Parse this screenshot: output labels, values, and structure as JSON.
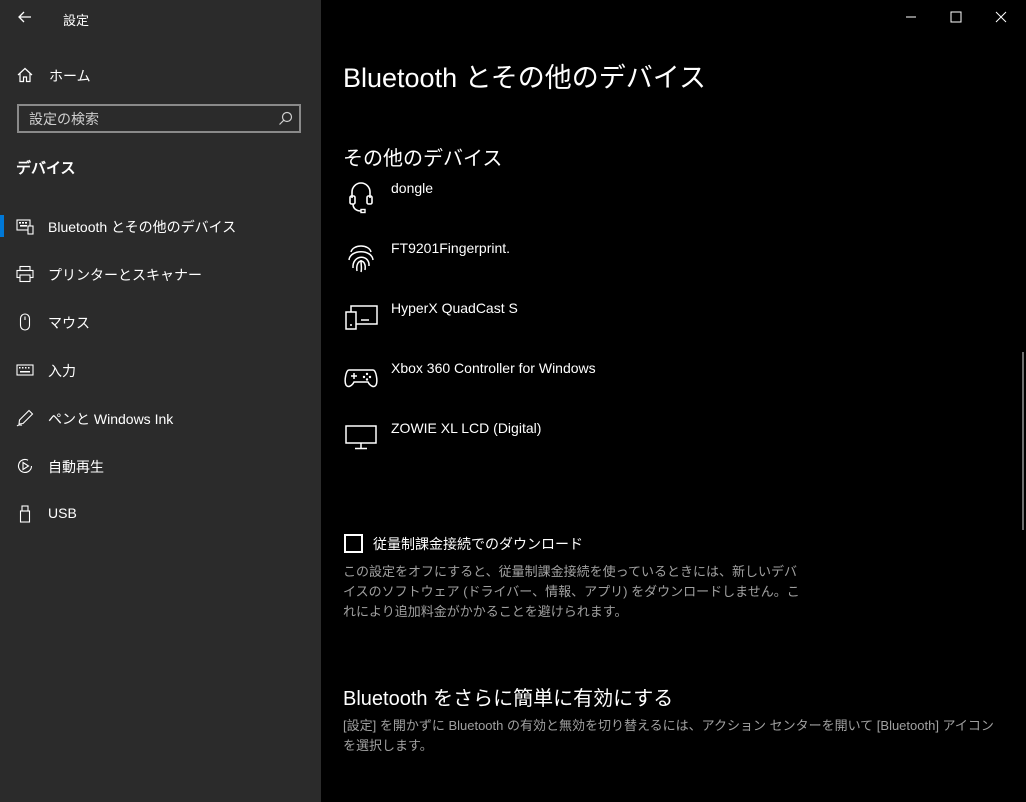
{
  "window": {
    "title": "設定"
  },
  "sidebar": {
    "home_label": "ホーム",
    "search_placeholder": "設定の検索",
    "section_title": "デバイス",
    "items": [
      {
        "label": "Bluetooth とその他のデバイス",
        "icon": "bluetooth-devices-icon",
        "active": true
      },
      {
        "label": "プリンターとスキャナー",
        "icon": "printer-icon"
      },
      {
        "label": "マウス",
        "icon": "mouse-icon"
      },
      {
        "label": "入力",
        "icon": "keyboard-icon"
      },
      {
        "label": "ペンと Windows Ink",
        "icon": "pen-icon"
      },
      {
        "label": "自動再生",
        "icon": "autoplay-icon"
      },
      {
        "label": "USB",
        "icon": "usb-icon"
      }
    ],
    "accent_color": "#0078d7"
  },
  "main": {
    "title": "Bluetooth とその他のデバイス",
    "other_devices_title": "その他のデバイス",
    "devices": [
      {
        "name": "dongle",
        "icon": "headset-icon"
      },
      {
        "name": "FT9201Fingerprint.",
        "icon": "fingerprint-icon"
      },
      {
        "name": "HyperX QuadCast S",
        "icon": "devices-icon"
      },
      {
        "name": "Xbox 360 Controller for Windows",
        "icon": "gamepad-icon"
      },
      {
        "name": "ZOWIE XL LCD (Digital)",
        "icon": "monitor-icon"
      }
    ],
    "metered": {
      "label": "従量制課金接続でのダウンロード",
      "checked": false,
      "description": "この設定をオフにすると、従量制課金接続を使っているときには、新しいデバイスのソフトウェア (ドライバー、情報、アプリ) をダウンロードしません。これにより追加料金がかかることを避けられます。"
    },
    "quick_section": {
      "title": "Bluetooth をさらに簡単に有効にする",
      "description": "[設定] を開かずに Bluetooth の有効と無効を切り替えるには、アクション センターを開いて [Bluetooth] アイコンを選択します。"
    }
  }
}
